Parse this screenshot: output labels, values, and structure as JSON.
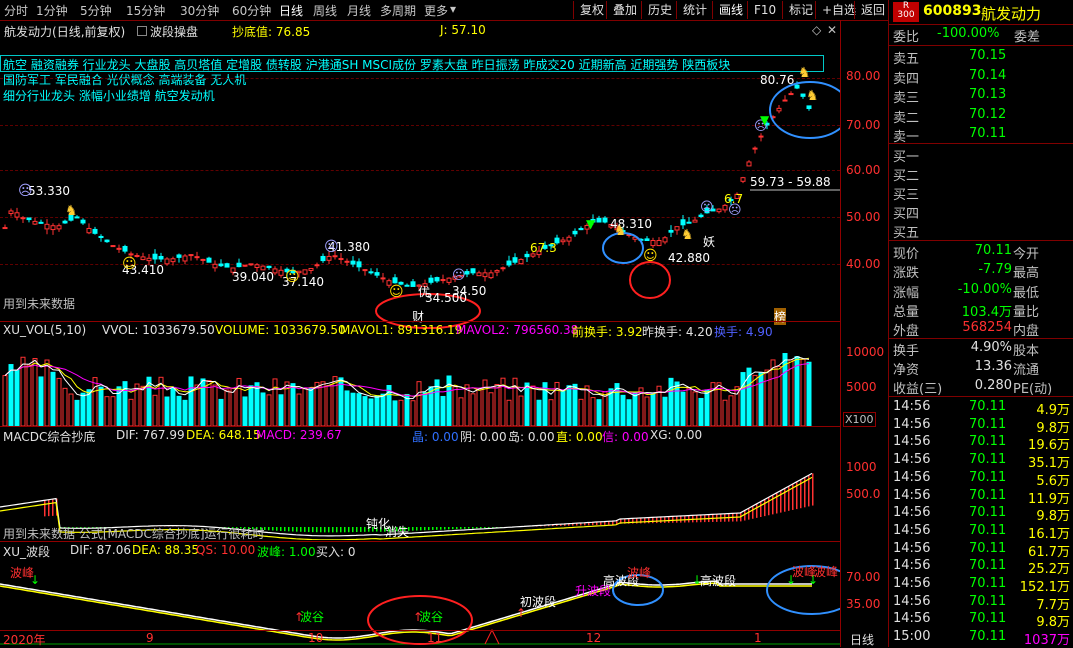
{
  "toolbar": {
    "periods": [
      "分时",
      "1分钟",
      "5分钟",
      "15分钟",
      "30分钟",
      "60分钟",
      "日线",
      "周线",
      "月线",
      "多周期",
      "更多"
    ],
    "active_period": "日线",
    "buttons": [
      "复权",
      "叠加",
      "历史",
      "统计",
      "画线",
      "F10",
      "标记",
      "+自选",
      "返回"
    ]
  },
  "header": {
    "stock": "航发动力",
    "adjust": "(日线,前复权)",
    "indicator": "波段操盘",
    "low_label": "抄底值: 76.85",
    "j_label": "J: 57.10"
  },
  "concepts": {
    "line1": "航空 融资融券 行业龙头 大盘股 高贝塔值 定增股 债转股 沪港通SH MSCI成份 罗素大盘 昨日振荡 昨成交20 近期新高 近期强势 陕西板块",
    "line2": "国防军工 军民融合 光伏概念 高端装备 无人机",
    "line3": "细分行业龙头 涨幅小业绩增 航空发动机"
  },
  "main_axis": {
    "labels": [
      "80.00",
      "70.00",
      "60.00",
      "50.00",
      "40.00"
    ]
  },
  "main_notes": {
    "future_data": "用到未来数据",
    "cai": "财",
    "bang": "榜",
    "yao": "妖",
    "you": "优",
    "range_label": "59.73 - 59.88",
    "price_labels": [
      "53.330",
      "43.410",
      "39.040",
      "37.140",
      "41.380",
      "34.500",
      "34.50",
      "48.310",
      "42.880",
      "80.76",
      "67.3",
      "6.7"
    ]
  },
  "vol": {
    "title": "XU_VOL(5,10)",
    "vvol": "VVOL: 1033679.50",
    "volume": "VOLUME: 1033679.50",
    "mavol1": "MAVOL1: 891316.19",
    "mavol2": "MAVOL2: 796560.38",
    "prev_turn": "前换手: 3.92",
    "yest_turn": "昨换手: 4.20",
    "turn": "换手: 4.90",
    "axis": [
      "10000",
      "5000"
    ],
    "unit": "X100"
  },
  "macd": {
    "title": "MACDC综合抄底",
    "dif": "DIF: 767.99",
    "dea": "DEA: 648.15",
    "macd": "MACD: 239.67",
    "extra": [
      "晶: 0.00",
      "阴: 0.00",
      "岛: 0.00",
      "直: 0.00",
      "信: 0.00",
      "XG: 0.00"
    ],
    "axis": [
      "1000",
      "500.0"
    ],
    "note": "用到未来数据 公式[MACDC综合抄底]运行很耗时",
    "tags": [
      "钝化",
      "消失"
    ]
  },
  "wave": {
    "title": "XU_波段",
    "dif": "DIF: 87.06",
    "dea": "DEA: 88.35",
    "qs": "QS: 10.00",
    "bofeng": "波峰: 1.00",
    "buy": "买入: 0",
    "axis": [
      "70.00",
      "35.00"
    ],
    "tags": [
      "波峰",
      "波谷",
      "波谷",
      "初波段",
      "升波段",
      "高波段",
      "波峰",
      "高波段",
      "波峰",
      "波峰"
    ]
  },
  "timeline": {
    "labels": [
      "2020年",
      "9",
      "10",
      "11",
      "12",
      "1"
    ],
    "period": "日线"
  },
  "panel": {
    "code": "600893",
    "name": "航发动力",
    "r_tag": "R",
    "r_num": "300",
    "weibi_label": "委比",
    "weibi_value": "-100.00%",
    "weicha_label": "委差",
    "asks": [
      {
        "label": "卖五",
        "price": "70.15"
      },
      {
        "label": "卖四",
        "price": "70.14"
      },
      {
        "label": "卖三",
        "price": "70.13"
      },
      {
        "label": "卖二",
        "price": "70.12"
      },
      {
        "label": "卖一",
        "price": "70.11"
      }
    ],
    "bids": [
      "买一",
      "买二",
      "买三",
      "买四",
      "买五"
    ],
    "stats": [
      {
        "l1": "现价",
        "v1": "70.11",
        "l2": "今开",
        "v2": ""
      },
      {
        "l1": "涨跌",
        "v1": "-7.79",
        "l2": "最高",
        "v2": ""
      },
      {
        "l1": "涨幅",
        "v1": "-10.00%",
        "l2": "最低",
        "v2": ""
      },
      {
        "l1": "总量",
        "v1": "103.4万",
        "l2": "量比",
        "v2": ""
      },
      {
        "l1": "外盘",
        "v1": "568254",
        "l2": "内盘",
        "v2": ""
      }
    ],
    "stats2": [
      {
        "l1": "换手",
        "v1": "4.90%",
        "l2": "股本"
      },
      {
        "l1": "净资",
        "v1": "13.36",
        "l2": "流通"
      },
      {
        "l1": "收益(三)",
        "v1": "0.280",
        "l2": "PE(动)"
      }
    ],
    "ticks": [
      {
        "t": "14:56",
        "p": "70.11",
        "v": "4.9万"
      },
      {
        "t": "14:56",
        "p": "70.11",
        "v": "9.8万"
      },
      {
        "t": "14:56",
        "p": "70.11",
        "v": "19.6万"
      },
      {
        "t": "14:56",
        "p": "70.11",
        "v": "35.1万"
      },
      {
        "t": "14:56",
        "p": "70.11",
        "v": "5.6万"
      },
      {
        "t": "14:56",
        "p": "70.11",
        "v": "11.9万"
      },
      {
        "t": "14:56",
        "p": "70.11",
        "v": "9.8万"
      },
      {
        "t": "14:56",
        "p": "70.11",
        "v": "16.1万"
      },
      {
        "t": "14:56",
        "p": "70.11",
        "v": "61.7万"
      },
      {
        "t": "14:56",
        "p": "70.11",
        "v": "25.2万"
      },
      {
        "t": "14:56",
        "p": "70.11",
        "v": "152.1万"
      },
      {
        "t": "14:56",
        "p": "70.11",
        "v": "7.7万"
      },
      {
        "t": "14:56",
        "p": "70.11",
        "v": "9.8万"
      },
      {
        "t": "15:00",
        "p": "70.11",
        "v": "1037万"
      }
    ]
  },
  "colors": {
    "up": "#ff3232",
    "down": "#00ffff",
    "yellow": "#ffff00",
    "magenta": "#ff00ff",
    "green": "#00ff00"
  }
}
